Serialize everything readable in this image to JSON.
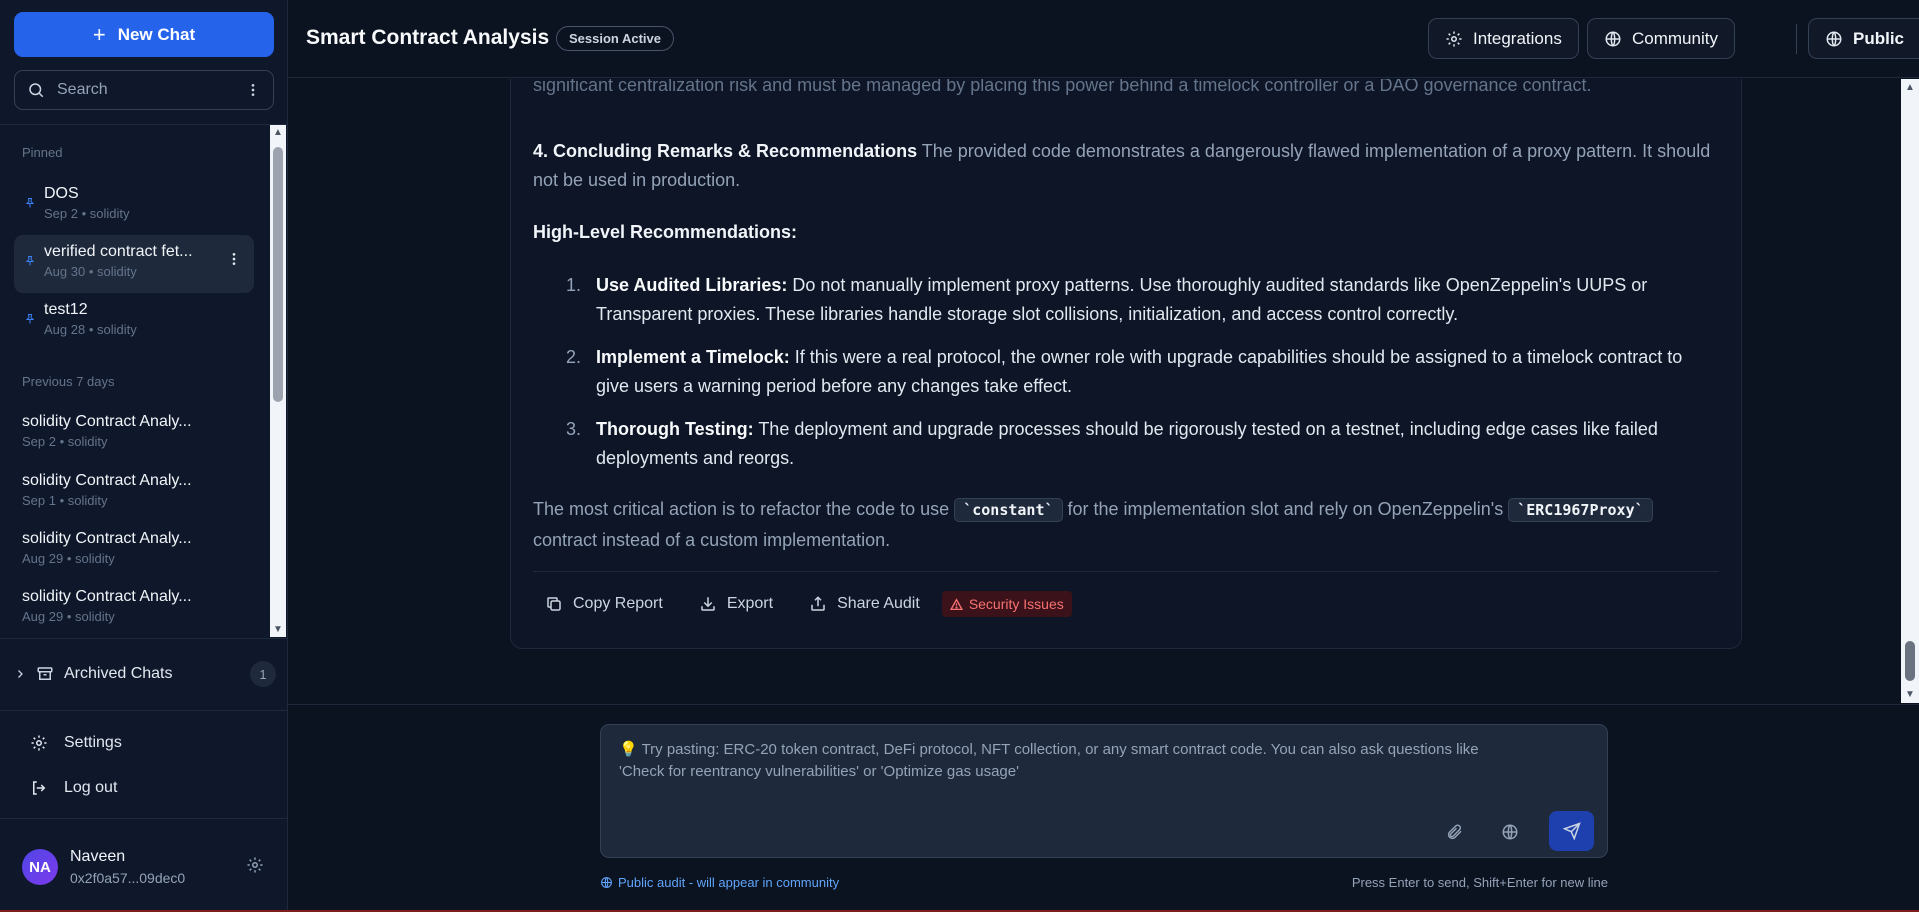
{
  "sidebar": {
    "new_chat_label": "New Chat",
    "search_placeholder": "Search",
    "pinned_label": "Pinned",
    "pinned": [
      {
        "title": "DOS",
        "meta": "Sep 2 • solidity"
      },
      {
        "title": "verified contract fet...",
        "meta": "Aug 30 • solidity"
      },
      {
        "title": "test12",
        "meta": "Aug 28 • solidity"
      }
    ],
    "recent_label": "Previous 7 days",
    "recent": [
      {
        "title": "solidity Contract Analy...",
        "meta": "Sep 2 • solidity"
      },
      {
        "title": "solidity Contract Analy...",
        "meta": "Sep 1 • solidity"
      },
      {
        "title": "solidity Contract Analy...",
        "meta": "Aug 29 • solidity"
      },
      {
        "title": "solidity Contract Analy...",
        "meta": "Aug 29 • solidity"
      }
    ],
    "archived_label": "Archived Chats",
    "archived_count": "1",
    "settings_label": "Settings",
    "logout_label": "Log out",
    "user": {
      "initials": "NA",
      "name": "Naveen",
      "address": "0x2f0a57...09dec0"
    }
  },
  "header": {
    "title": "Smart Contract Analysis",
    "badge": "Session Active",
    "integrations_label": "Integrations",
    "community_label": "Community",
    "visibility_label": "Public"
  },
  "report": {
    "top_line_1": "significant centralization risk and must be managed by placing this power behind a timelock controller or a DAO governance contract.",
    "concluding_heading": "4. Concluding Remarks & Recommendations",
    "concluding_text": " The provided code demonstrates a dangerously flawed implementation of a proxy pattern. It should not be used in production.",
    "high_level_heading": "High-Level Recommendations:",
    "recommendations": [
      {
        "num": "1.",
        "title": "Use Audited Libraries:",
        "text": " Do not manually implement proxy patterns. Use thoroughly audited standards like OpenZeppelin's UUPS or Transparent proxies. These libraries handle storage slot collisions, initialization, and access control correctly."
      },
      {
        "num": "2.",
        "title": "Implement a Timelock:",
        "text": " If this were a real protocol, the owner role with upgrade capabilities should be assigned to a timelock contract to give users a warning period before any changes take effect."
      },
      {
        "num": "3.",
        "title": "Thorough Testing:",
        "text": " The deployment and upgrade processes should be rigorously tested on a testnet, including edge cases like failed deployments and reorgs."
      }
    ],
    "final_pre": "The most critical action is to refactor the code to use ",
    "final_code_1": "`constant`",
    "final_mid": " for the implementation slot and rely on OpenZeppelin's ",
    "final_code_2": "`ERC1967Proxy`",
    "final_post": " contract instead of a custom implementation.",
    "actions": {
      "copy": "Copy Report",
      "export": "Export",
      "share": "Share Audit",
      "security": "Security Issues"
    }
  },
  "composer": {
    "placeholder": "💡 Try pasting: ERC-20 token contract, DeFi protocol, NFT collection, or any smart contract code. You can also ask questions like 'Check for reentrancy vulnerabilities' or 'Optimize gas usage'",
    "public_hint": "Public audit - will appear in community",
    "enter_hint": "Press Enter to send, Shift+Enter for new line"
  },
  "colors": {
    "accent": "#2563eb",
    "background": "#0b1220",
    "danger": "#f87171"
  }
}
